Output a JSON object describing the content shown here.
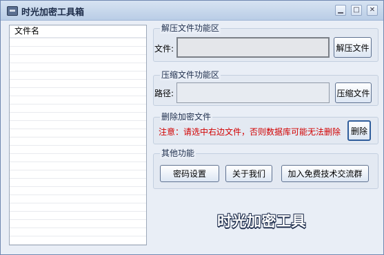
{
  "window": {
    "title": "时光加密工具箱",
    "minimize_glyph": "▁",
    "maximize_glyph": "□",
    "close_glyph": "✕"
  },
  "file_list": {
    "column_header": "文件名",
    "items": []
  },
  "decompress": {
    "title": "解压文件功能区",
    "file_label": "文件:",
    "file_value": "",
    "button": "解压文件"
  },
  "compress": {
    "title": "压缩文件功能区",
    "path_label": "路径:",
    "path_value": "",
    "button": "压缩文件"
  },
  "delete": {
    "title": "删除加密文件",
    "warning": "注意：请选中右边文件，否则数据库可能无法删除",
    "button": "删除"
  },
  "other": {
    "title": "其他功能",
    "buttons": [
      "密码设置",
      "关于我们",
      "加入免费技术交流群"
    ]
  },
  "brand_text": "时光加密工具",
  "colors": {
    "warning": "#d20000",
    "title_bar": "#c6d6ec",
    "panel": "#e3e9f2"
  }
}
